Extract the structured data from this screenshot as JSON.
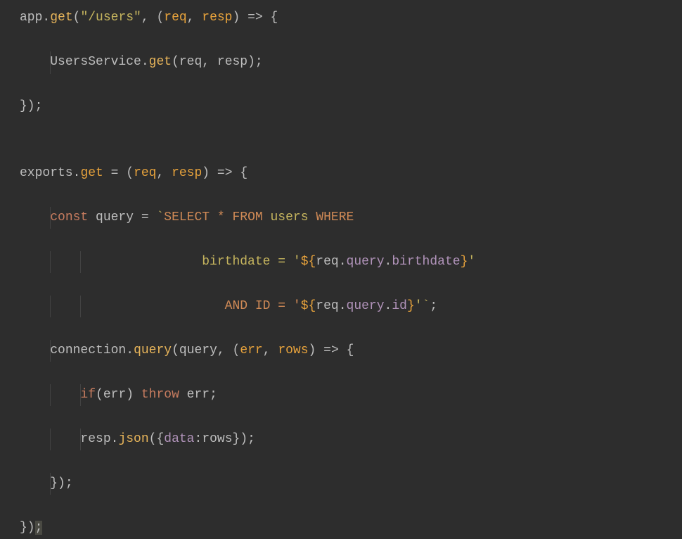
{
  "code": {
    "line1": {
      "t1": "app",
      "t2": ".",
      "t3": "get",
      "t4": "(",
      "t5": "\"/users\"",
      "t6": ", (",
      "t7": "req",
      "t8": ", ",
      "t9": "resp",
      "t10": ") ",
      "t11": "=>",
      "t12": " {"
    },
    "line2": {
      "t1": "UsersService",
      "t2": ".",
      "t3": "get",
      "t4": "(",
      "t5": "req",
      "t6": ", ",
      "t7": "resp",
      "t8": ");"
    },
    "line3": {
      "t1": "});"
    },
    "line4": {
      "blank": ""
    },
    "line5": {
      "t1": "exports",
      "t2": ".",
      "t3": "get",
      "t4": " = (",
      "t5": "req",
      "t6": ", ",
      "t7": "resp",
      "t8": ") ",
      "t9": "=>",
      "t10": " {"
    },
    "line6": {
      "t1": "const ",
      "t2": "query",
      "t3": " = ",
      "t4": "`",
      "t5": "SELECT * FROM ",
      "t6": "users",
      "t7": " WHERE"
    },
    "line7": {
      "t1": "birthdate = '",
      "t2": "${",
      "t3": "req",
      "t4": ".",
      "t5": "query",
      "t6": ".",
      "t7": "birthdate",
      "t8": "}",
      "t9": "'"
    },
    "line8": {
      "t1": "AND ID = '",
      "t2": "${",
      "t3": "req",
      "t4": ".",
      "t5": "query",
      "t6": ".",
      "t7": "id",
      "t8": "}",
      "t9": "'",
      "t10": "`",
      "t11": ";"
    },
    "line9": {
      "t1": "connection",
      "t2": ".",
      "t3": "query",
      "t4": "(",
      "t5": "query",
      "t6": ", (",
      "t7": "err",
      "t8": ", ",
      "t9": "rows",
      "t10": ") ",
      "t11": "=>",
      "t12": " {"
    },
    "line10": {
      "t1": "if",
      "t2": "(",
      "t3": "err",
      "t4": ") ",
      "t5": "throw ",
      "t6": "err",
      "t7": ";"
    },
    "line11": {
      "t1": "resp",
      "t2": ".",
      "t3": "json",
      "t4": "({",
      "t5": "data",
      "t6": ":",
      "t7": "rows",
      "t8": "});"
    },
    "line12": {
      "t1": "});"
    },
    "line13": {
      "t1": "})",
      "t2": ";"
    }
  }
}
